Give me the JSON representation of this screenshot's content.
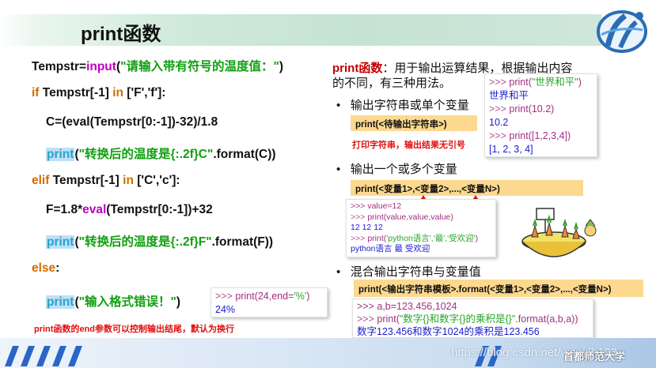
{
  "slide": {
    "title": "print函数",
    "code_lines": [
      {
        "pre": "Tempstr=",
        "fn": "input",
        "mid": "(",
        "str": "\"请输入带有符号的温度值：\"",
        "post": ")"
      },
      {
        "kw": "if",
        "mid": " Tempstr[-1] ",
        "kw2": "in",
        "post": " ['F','f']:"
      },
      {
        "text": "C=(eval(Tempstr[0:-1])-32)/1.8"
      },
      {
        "pr": "print",
        "mid": "(",
        "str": "\"转换后的温度是{:.2f}C\"",
        "post": ".format(C))"
      },
      {
        "kw": "elif",
        "mid": " Tempstr[-1] ",
        "kw2": "in",
        "post": " ['C','c']:"
      },
      {
        "pre": "F=1.8*",
        "fn": "eval",
        "post": "(Tempstr[0:-1])+32"
      },
      {
        "pr": "print",
        "mid": "(",
        "str": "\"转换后的温度是{:.2f}F\"",
        "post": ".format(F))"
      },
      {
        "kw": "else",
        "post": ":"
      },
      {
        "pr": "print",
        "mid": "(",
        "str": "\"输入格式错误！\"",
        "post": ")"
      }
    ],
    "end_note": "print函数的end参数可以控制输出结尾，默认为换行",
    "end_shell": {
      "prompt": ">>> ",
      "call": "print(24,end=",
      "arg": "'%'",
      "close": ")",
      "out": "24%"
    },
    "desc_title": "print函数",
    "desc_line1": "：用于输出运算结果，根据输出内容",
    "desc_line2": "的不同，有三种用法。",
    "bullets": [
      "输出字符串或单个变量",
      "输出一个或多个变量",
      "混合输出字符串与变量值"
    ],
    "bar1": "print(<待输出字符串>)",
    "note1": "打印字符串，输出结果无引号",
    "shell1": {
      "l1_prompt": ">>> ",
      "l1_call": "print(",
      "l1_str": "\"世界和平\"",
      "l1_close": ")",
      "l2": "世界和平",
      "l3_prompt": ">>> ",
      "l3_call": "print(10.2)",
      "l4": "10.2",
      "l5_prompt": ">>> ",
      "l5_call": "print([1,2,3,4])",
      "l6": "[1, 2, 3, 4]"
    },
    "bar2": "print(<变量1>,<变量2>,...,<变量N>)",
    "shell2": {
      "l1": ">>> value=12",
      "l2_prompt": ">>> ",
      "l2_call": "print(value,value,value)",
      "l3": "12 12 12",
      "l4_prompt": ">>> ",
      "l4_call": "print(",
      "l4_str": "'python语言','最','受欢迎'",
      "l4_close": ")",
      "l5": "python语言 最 受欢迎"
    },
    "bar3": "print(<输出字符串模板>.format(<变量1>,<变量2>,...,<变量N>)",
    "shell3": {
      "l1": ">>> a,b=123.456,1024",
      "l2_prompt": ">>> ",
      "l2_call": "print(",
      "l2_str": "\"数字{}和数字{}的乘积是{}\"",
      "l2_close": ".format(a,b,a))",
      "l3": "数字123.456和数字1024的乘积是123.456"
    },
    "watermark": "https://blog.csdn.net/wenxlh123",
    "university": "首都师范大学"
  },
  "colors": {
    "keyword": "#d06d00",
    "builtin": "#c000c0",
    "string": "#10a010",
    "print_highlight": "#bde2f4",
    "note_red": "#e01010",
    "bar_fill": "#fcd98f",
    "title_band": "#c6e3d2"
  },
  "icons": [
    "university-logo-icon",
    "red-triangle-marker-icon",
    "cartoon-carrot-pot-image",
    "footer-stripe-icon"
  ]
}
